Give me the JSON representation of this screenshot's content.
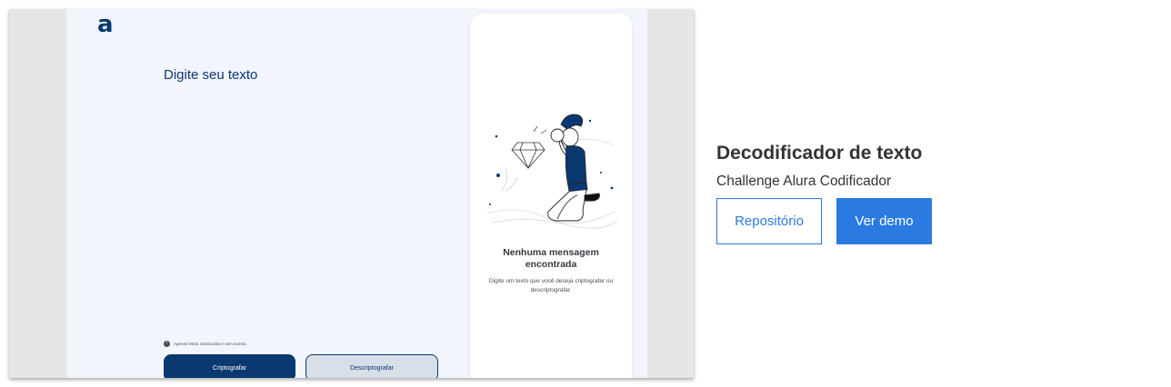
{
  "preview": {
    "logo": "a",
    "prompt": "Digite seu texto",
    "hint_icon": "info-icon",
    "hint": "Apenas letras minúsculas e sem acento.",
    "encrypt_label": "Criptografar",
    "decrypt_label": "Descriptografar",
    "empty_title": "Nenhuma mensagem encontrada",
    "empty_desc": "Digite um texto que você deseja criptografar ou descriptografar.",
    "illustration": "person-with-magnifier-illustration",
    "colors": {
      "primary": "#0a3871",
      "background": "#f2f5fc"
    }
  },
  "project": {
    "title": "Decodificador de texto",
    "subtitle": "Challenge Alura Codificador",
    "repo_label": "Repositório",
    "demo_label": "Ver demo",
    "colors": {
      "accent": "#2a7ae2",
      "text": "#333333"
    }
  }
}
